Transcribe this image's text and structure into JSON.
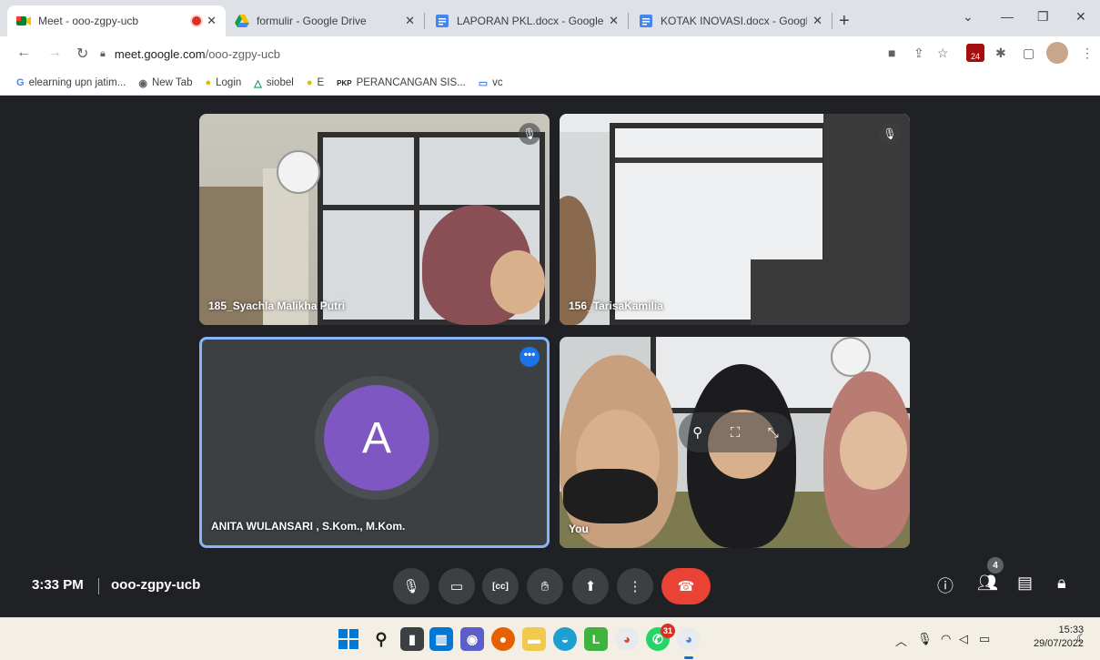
{
  "tabs": [
    {
      "title": "Meet - ooo-zgpy-ucb",
      "recording": true
    },
    {
      "title": "formulir - Google Drive"
    },
    {
      "title": "LAPORAN PKL.docx - Google Do"
    },
    {
      "title": "KOTAK INOVASI.docx - Google D"
    }
  ],
  "address": {
    "host": "meet.google.com",
    "path": "/ooo-zgpy-ucb"
  },
  "bookmarks": [
    {
      "label": "elearning upn jatim..."
    },
    {
      "label": "New Tab"
    },
    {
      "label": "Login"
    },
    {
      "label": "siobel"
    },
    {
      "label": "E"
    },
    {
      "label": "PERANCANGAN SIS..."
    },
    {
      "label": "vc"
    }
  ],
  "participants": [
    {
      "name": "185_Syachla Malikha Putri",
      "muted": true
    },
    {
      "name": "156_TarisaKamilia",
      "muted": true
    },
    {
      "name": "ANITA WULANSARI , S.Kom., M.Kom.",
      "avatar_letter": "A",
      "avatar_color": "#7e57c2"
    },
    {
      "name": "You"
    }
  ],
  "meeting": {
    "time": "3:33 PM",
    "code": "ooo-zgpy-ucb",
    "people_count": "4"
  },
  "extension_badge": "24",
  "taskbar": {
    "chrome_badge": "31",
    "time": "15:33",
    "date": "29/07/2022"
  },
  "colors": {
    "end_call": "#ea4335",
    "active_tile_border": "#8ab4f8",
    "meet_bg": "#202124"
  }
}
